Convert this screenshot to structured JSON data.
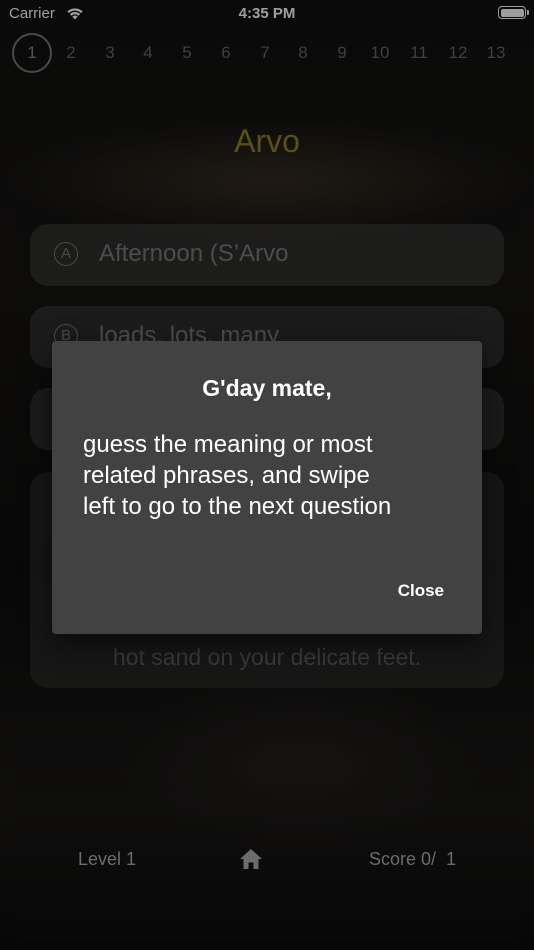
{
  "status_bar": {
    "carrier": "Carrier",
    "time": "4:35 PM"
  },
  "question_numbers": [
    "1",
    "2",
    "3",
    "4",
    "5",
    "6",
    "7",
    "8",
    "9",
    "10",
    "11",
    "12",
    "13"
  ],
  "current_question": "1",
  "word": "Arvo",
  "options": [
    {
      "letter": "A",
      "text": "Afternoon (S’Arvo"
    },
    {
      "letter": "B",
      "text": "loads, lots, many"
    },
    {
      "letter": "C",
      "text": ""
    }
  ],
  "example_text": "hot sand on your delicate feet.",
  "dialog": {
    "title": "G'day mate,",
    "body_lines": [
      "guess the meaning or most",
      "related phrases, and swipe",
      "left to go to the next question"
    ],
    "close_label": "Close"
  },
  "footer": {
    "level_label": "Level 1",
    "score_label": "Score 0/  1",
    "home_icon": "home-icon"
  },
  "colors": {
    "word": "#8f8228",
    "dialog_bg": "#424242"
  }
}
